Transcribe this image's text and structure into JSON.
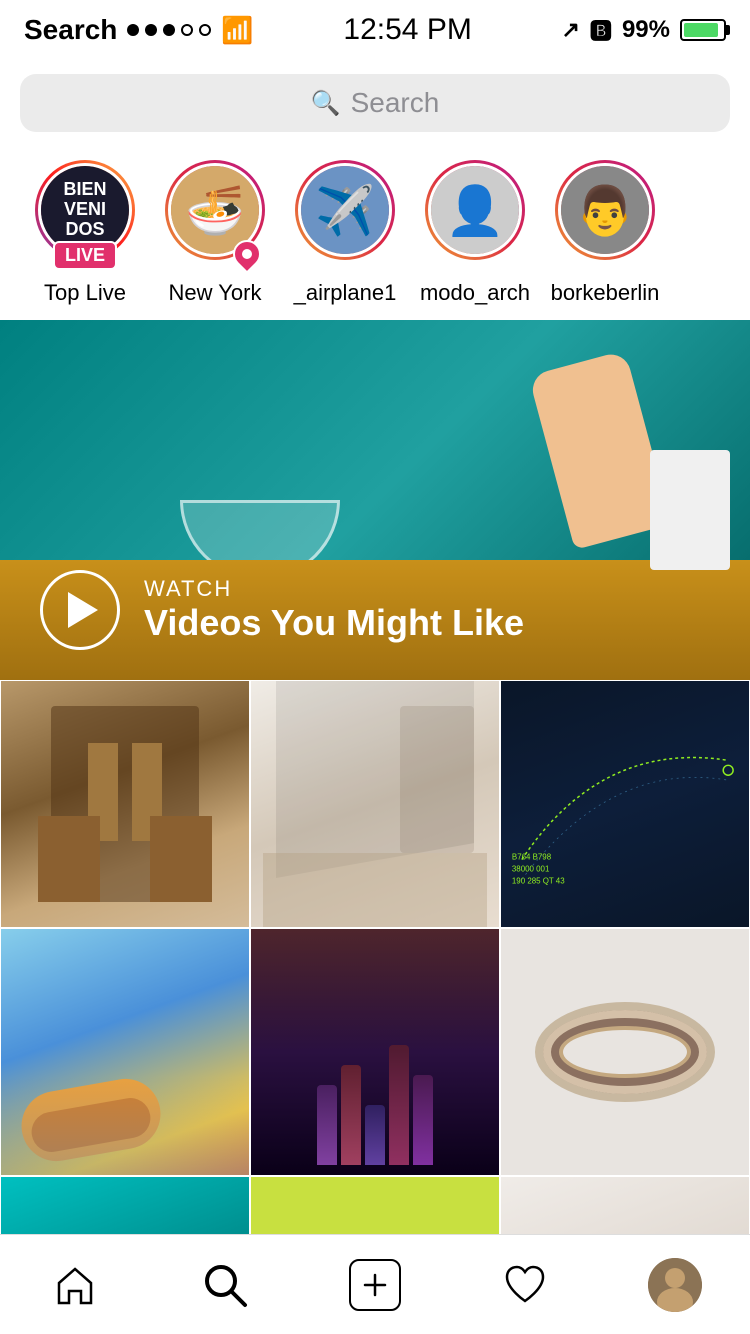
{
  "statusBar": {
    "backLabel": "Search",
    "time": "12:54 PM",
    "batteryPercent": "99%",
    "signalBars": [
      true,
      true,
      true,
      true,
      false
    ]
  },
  "searchBar": {
    "placeholder": "Search"
  },
  "stories": [
    {
      "id": "top-live",
      "label": "Top Live",
      "ring": "live",
      "badge": "LIVE",
      "avatar": "bienvenidos"
    },
    {
      "id": "new-york",
      "label": "New York",
      "ring": "gradient",
      "pin": true,
      "avatar": "newyork"
    },
    {
      "id": "airplane1",
      "label": "_airplane1",
      "ring": "gradient",
      "avatar": "airplane"
    },
    {
      "id": "modo-arch",
      "label": "modo_arch",
      "ring": "gradient",
      "avatar": "modo"
    },
    {
      "id": "borkeberlin",
      "label": "borkeberlin",
      "ring": "gradient",
      "avatar": "borke"
    }
  ],
  "watchSection": {
    "label": "WATCH",
    "title": "Videos You Might Like"
  },
  "gridImages": {
    "row1": [
      {
        "id": "building",
        "type": "building"
      },
      {
        "id": "stairs",
        "type": "stairs"
      },
      {
        "id": "flightmap",
        "type": "flightmap"
      }
    ],
    "row2": [
      {
        "id": "hotdog",
        "type": "hotdog"
      },
      {
        "id": "fantasy",
        "type": "fantasy"
      },
      {
        "id": "oval",
        "type": "oval"
      }
    ],
    "row3": [
      {
        "id": "teal",
        "type": "teal"
      },
      {
        "id": "partial",
        "type": "partial"
      },
      {
        "id": "partial2",
        "type": "partial2"
      }
    ]
  },
  "bottomNav": {
    "items": [
      {
        "id": "home",
        "label": "Home",
        "icon": "house"
      },
      {
        "id": "search",
        "label": "Search",
        "icon": "search",
        "active": true
      },
      {
        "id": "add",
        "label": "Add",
        "icon": "plus"
      },
      {
        "id": "likes",
        "label": "Likes",
        "icon": "heart"
      },
      {
        "id": "profile",
        "label": "Profile",
        "icon": "avatar"
      }
    ]
  },
  "bienvenidosText": {
    "line1": "BIEN",
    "line2": "VENI",
    "line3": "DOS"
  }
}
